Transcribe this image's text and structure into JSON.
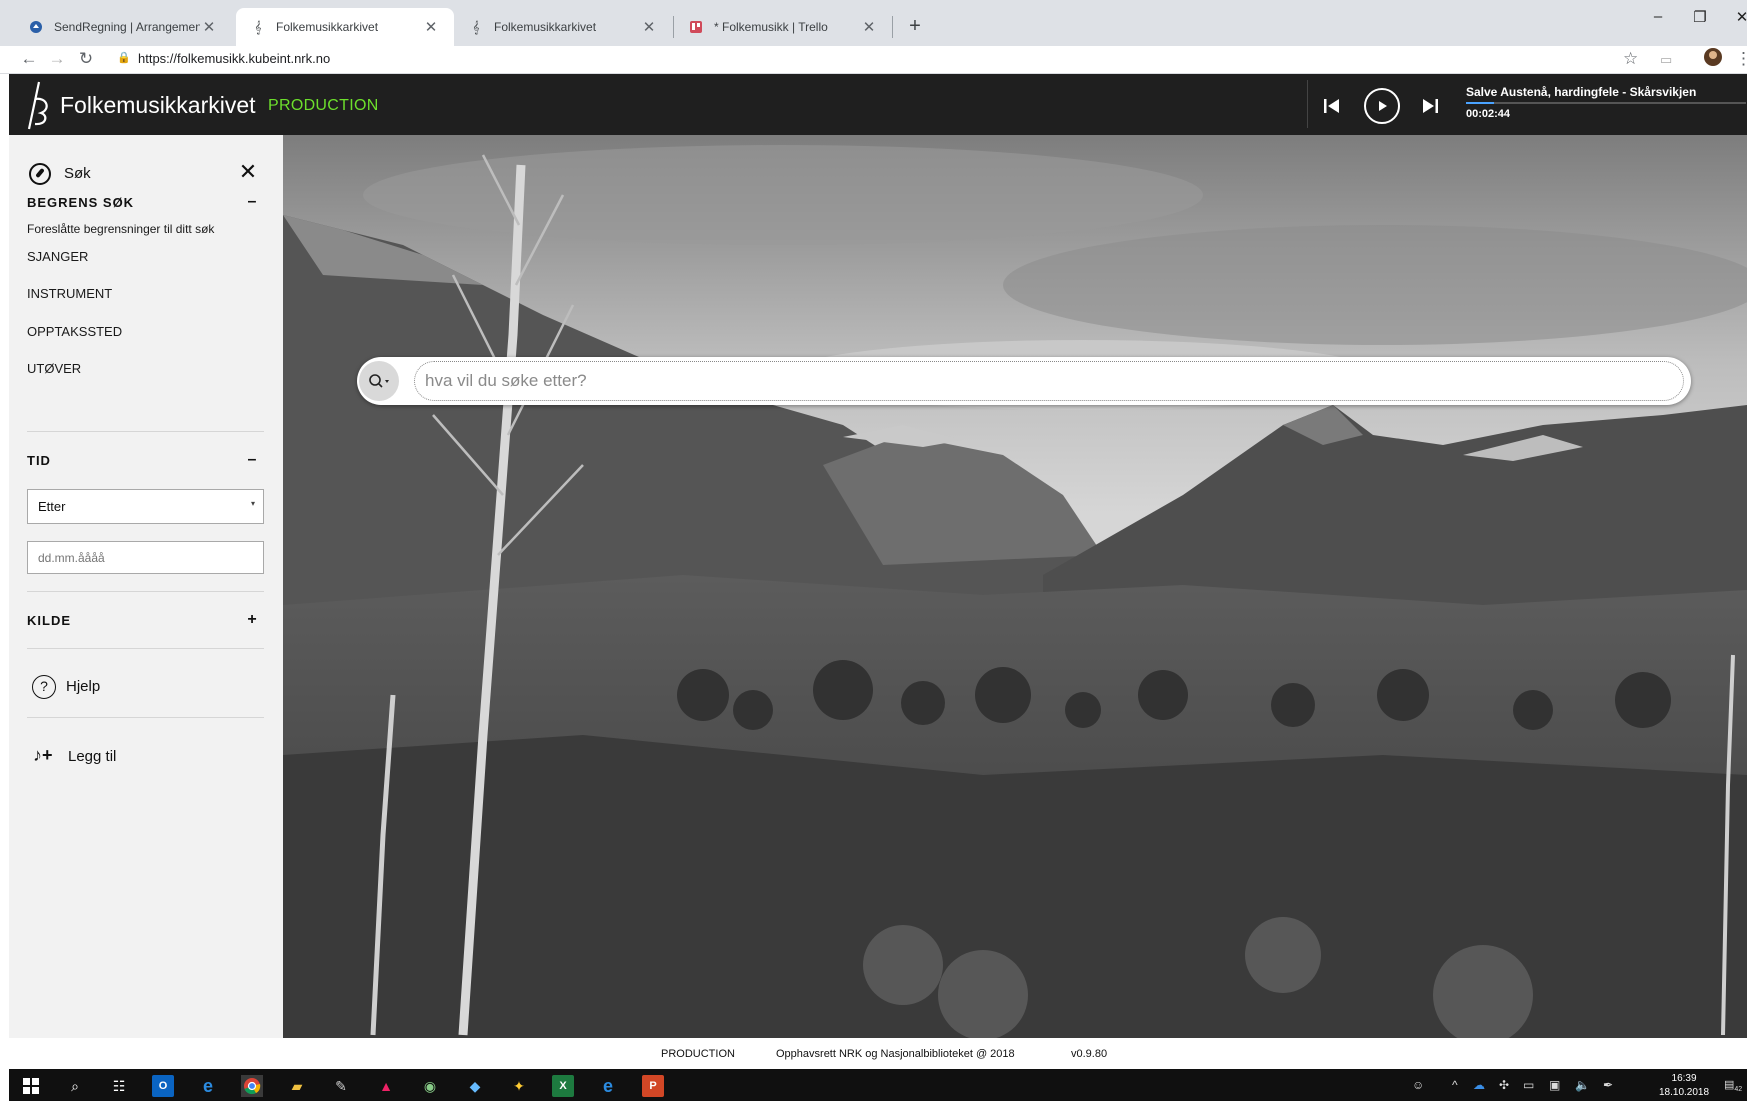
{
  "browser": {
    "tabs": [
      {
        "title": "SendRegning | Arrangement",
        "active": false
      },
      {
        "title": "Folkemusikkarkivet",
        "active": true
      },
      {
        "title": "Folkemusikkarkivet",
        "active": false
      },
      {
        "title": "* Folkemusikk | Trello",
        "active": false
      }
    ],
    "url": "https://folkemusikk.kubeint.nrk.no"
  },
  "header": {
    "brand": "Folkemusikkarkivet",
    "environment": "PRODUCTION",
    "environment_color": "#6ddf2c"
  },
  "player": {
    "track": "Salve Austenå, hardingfele - Skårsvikjen",
    "time": "00:02:44",
    "progress_fraction": 0.1
  },
  "sidebar": {
    "title": "Søk",
    "limit": {
      "heading": "BEGRENS SØK",
      "toggle": "–",
      "hint": "Foreslåtte begrensninger til ditt søk",
      "items": [
        "SJANGER",
        "INSTRUMENT",
        "OPPTAKSSTED",
        "UTØVER"
      ]
    },
    "time": {
      "heading": "TID",
      "toggle": "–",
      "select_value": "Etter",
      "date_placeholder": "dd.mm.åååå"
    },
    "source": {
      "heading": "KILDE",
      "toggle": "+"
    },
    "help": "Hjelp",
    "add": "Legg til"
  },
  "search": {
    "placeholder": "hva vil du søke etter?"
  },
  "footer": {
    "environment": "PRODUCTION",
    "copyright": "Opphavsrett NRK og Nasjonalbiblioteket @ 2018",
    "version": "v0.9.80"
  },
  "taskbar": {
    "time": "16:39",
    "date": "18.10.2018",
    "notifications": "42"
  }
}
